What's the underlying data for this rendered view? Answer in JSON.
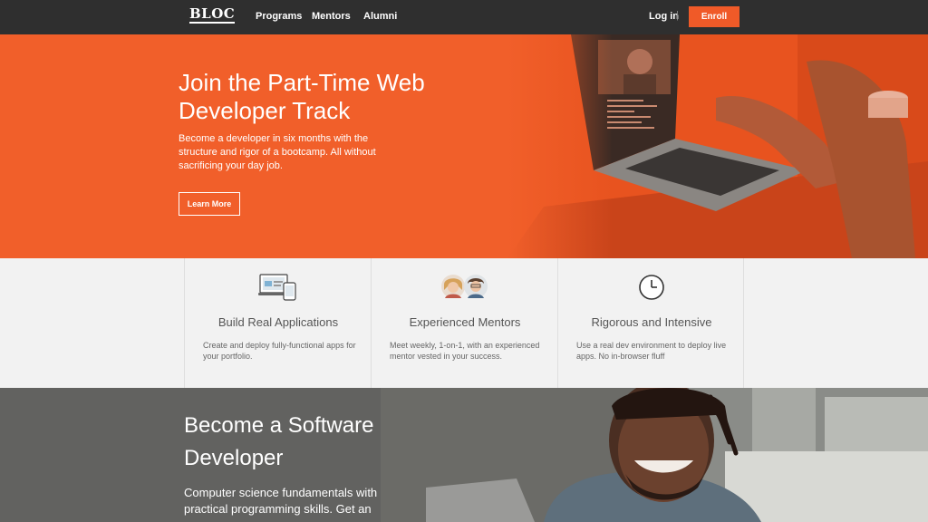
{
  "nav": {
    "logo": "BLOC",
    "links": [
      "Programs",
      "Mentors",
      "Alumni"
    ],
    "login": "Log in",
    "separator": "|",
    "enroll": "Enroll"
  },
  "hero": {
    "title": "Join the Part-Time Web Developer Track",
    "subtitle": "Become a developer in six months with the structure and rigor of a bootcamp. All without sacrificing your day job.",
    "cta": "Learn More",
    "bg_color": "#f15f2a"
  },
  "features": [
    {
      "icon": "devices-icon",
      "title": "Build Real Applications",
      "text": "Create and deploy fully-functional apps for your portfolio."
    },
    {
      "icon": "mentors-avatars-icon",
      "title": "Experienced Mentors",
      "text": "Meet weekly, 1-on-1, with an experienced mentor vested in your success."
    },
    {
      "icon": "clock-icon",
      "title": "Rigorous and Intensive",
      "text": "Use a real dev environment to deploy live apps. No in-browser fluff"
    }
  ],
  "hero2": {
    "title": "Become a Software Developer",
    "text": "Computer science fundamentals with practical programming skills. Get an"
  },
  "colors": {
    "accent": "#f05a28",
    "nav_bg": "#2f2f2f"
  }
}
